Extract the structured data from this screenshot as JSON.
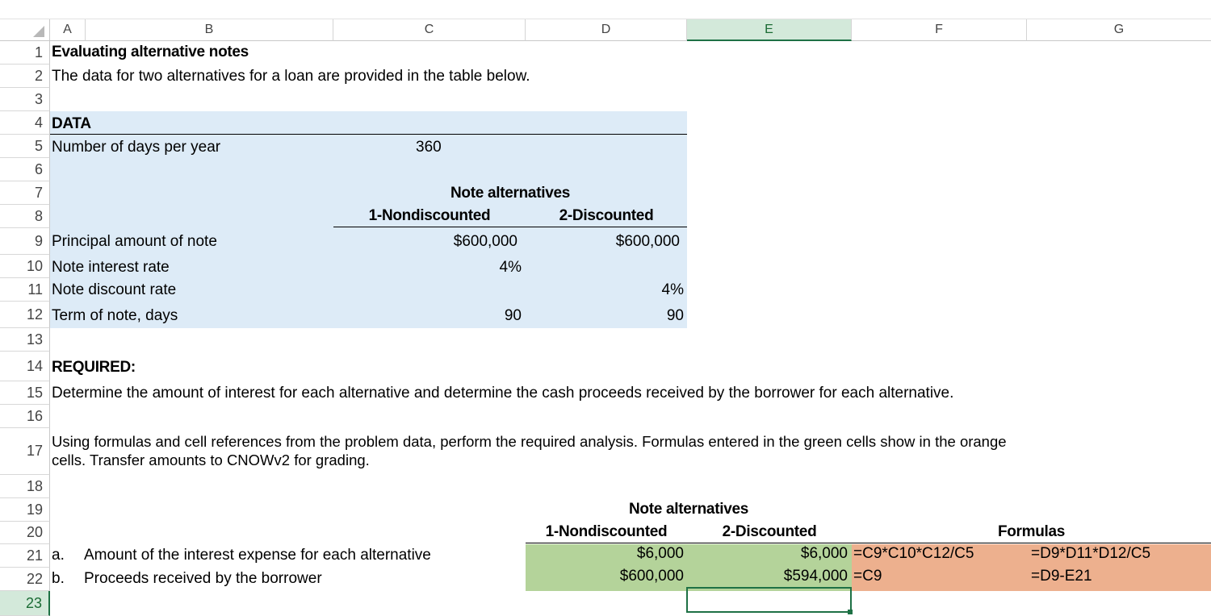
{
  "columns": [
    "A",
    "B",
    "C",
    "D",
    "E",
    "F",
    "G"
  ],
  "rows": [
    "1",
    "2",
    "3",
    "4",
    "5",
    "6",
    "7",
    "8",
    "9",
    "10",
    "11",
    "12",
    "13",
    "14",
    "15",
    "16",
    "17",
    "18",
    "19",
    "20",
    "21",
    "22",
    "23"
  ],
  "sheet": {
    "title": "Evaluating alternative notes",
    "intro": "The data for two alternatives for a loan are provided in the table below.",
    "data_heading": "DATA",
    "days_label": "Number of days per year",
    "days_value": "360",
    "note_alternatives": "Note alternatives",
    "alt1": "1-Nondiscounted",
    "alt2": "2-Discounted",
    "principal_label": "Principal amount of note",
    "principal_alt1": "$600,000",
    "principal_alt2": "$600,000",
    "interest_rate_label": "Note interest rate",
    "interest_rate_alt1": "4%",
    "discount_rate_label": "Note discount rate",
    "discount_rate_alt2": "4%",
    "term_label": "Term of note, days",
    "term_alt1": "90",
    "term_alt2": "90",
    "required_heading": "REQUIRED:",
    "required_text": "Determine the amount of interest for each alternative and determine the cash proceeds received by the borrower for each alternative.",
    "instructions": "Using formulas and cell references from the problem data, perform the required analysis. Formulas entered in the green cells show in the orange cells. Transfer amounts to CNOWv2 for grading.",
    "answer_note_alternatives": "Note alternatives",
    "answer_alt1": "1-Nondiscounted",
    "answer_alt2": "2-Discounted",
    "formulas_heading": "Formulas",
    "item_a_letter": "a.",
    "item_a_label": "Amount of the interest expense for each alternative",
    "item_a_alt1": "$6,000",
    "item_a_alt2": "$6,000",
    "item_a_formula1": "=C9*C10*C12/C5",
    "item_a_formula2": "=D9*D11*D12/C5",
    "item_b_letter": "b.",
    "item_b_label": "Proceeds received by the borrower",
    "item_b_alt1": "$600,000",
    "item_b_alt2": "$594,000",
    "item_b_formula1": "=C9",
    "item_b_formula2": "=D9-E21"
  },
  "colors": {
    "data_fill": "#ddebf7",
    "green_cells": "#b4d39a",
    "orange_cells": "#edb08e",
    "selection": "#1e7145"
  }
}
